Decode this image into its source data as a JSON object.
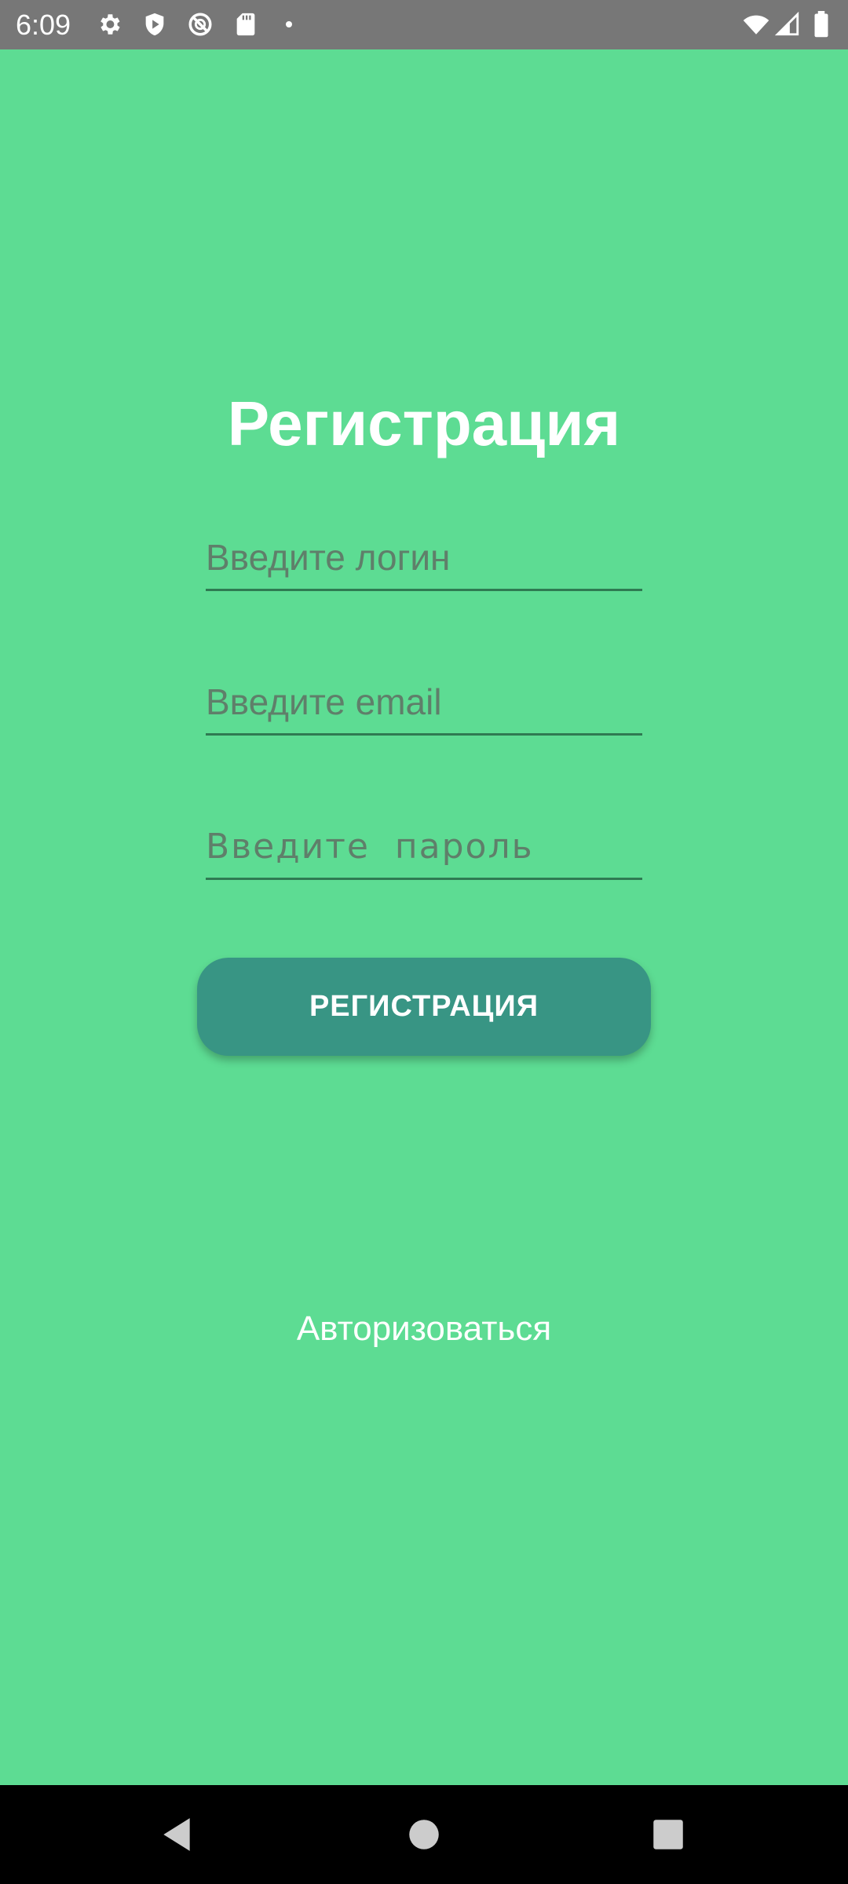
{
  "status_bar": {
    "time": "6:09",
    "icons": [
      "gear-icon",
      "play-protect-icon",
      "do-not-disturb-icon",
      "sd-card-icon",
      "dot-icon",
      "wifi-icon",
      "signal-icon",
      "battery-icon"
    ]
  },
  "colors": {
    "background": "#5ddc93",
    "button": "#389584",
    "underline": "#2f7a52",
    "status_bar": "#777777"
  },
  "form": {
    "title": "Регистрация",
    "login_placeholder": "Введите логин",
    "email_placeholder": "Введите email",
    "password_placeholder": "Введите  пароль",
    "submit_label": "РЕГИСТРАЦИЯ"
  },
  "link": {
    "login_label": "Авторизоваться"
  },
  "nav_bar": {
    "buttons": [
      "back-icon",
      "home-icon",
      "recents-icon"
    ]
  }
}
